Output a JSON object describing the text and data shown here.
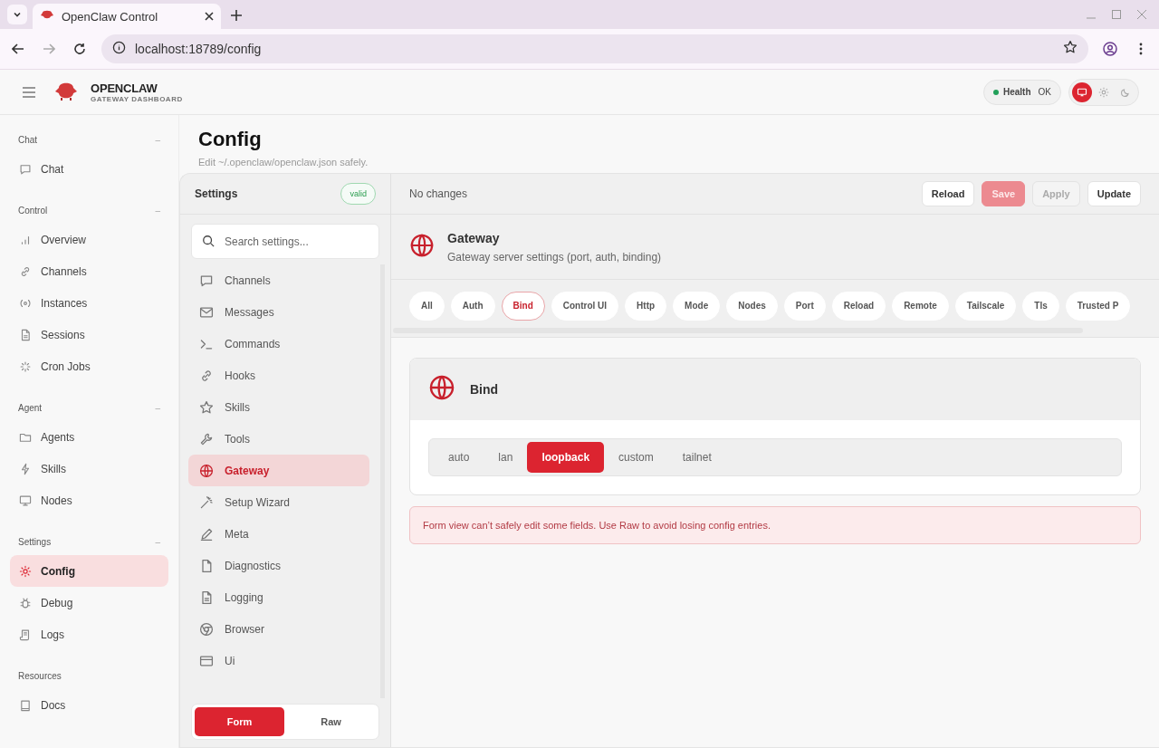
{
  "browser": {
    "tab_title": "OpenClaw Control",
    "url": "localhost:18789/config"
  },
  "app": {
    "brand": "OPENCLAW",
    "subtitle": "GATEWAY DASHBOARD",
    "health": {
      "label": "Health",
      "value": "OK"
    },
    "theme": [
      {
        "kind": "system",
        "selected": true
      },
      {
        "kind": "light",
        "selected": false
      },
      {
        "kind": "dark",
        "selected": false
      }
    ]
  },
  "sidebar": {
    "groups": [
      {
        "label": "Chat",
        "collapse": "–",
        "items": [
          {
            "label": "Chat",
            "selected": false
          }
        ]
      },
      {
        "label": "Control",
        "collapse": "–",
        "items": [
          {
            "label": "Overview",
            "selected": false
          },
          {
            "label": "Channels",
            "selected": false
          },
          {
            "label": "Instances",
            "selected": false
          },
          {
            "label": "Sessions",
            "selected": false
          },
          {
            "label": "Cron Jobs",
            "selected": false
          }
        ]
      },
      {
        "label": "Agent",
        "collapse": "–",
        "items": [
          {
            "label": "Agents",
            "selected": false
          },
          {
            "label": "Skills",
            "selected": false
          },
          {
            "label": "Nodes",
            "selected": false
          }
        ]
      },
      {
        "label": "Settings",
        "collapse": "–",
        "items": [
          {
            "label": "Config",
            "selected": true
          },
          {
            "label": "Debug",
            "selected": false
          },
          {
            "label": "Logs",
            "selected": false
          }
        ]
      },
      {
        "label": "Resources",
        "items": [
          {
            "label": "Docs",
            "selected": false
          }
        ]
      }
    ]
  },
  "page": {
    "title": "Config",
    "subtitle": "Edit ~/.openclaw/openclaw.json safely."
  },
  "settings": {
    "title": "Settings",
    "badge": "valid",
    "search": {
      "placeholder": "Search settings..."
    },
    "sections": [
      {
        "label": "Channels",
        "selected": false
      },
      {
        "label": "Messages",
        "selected": false
      },
      {
        "label": "Commands",
        "selected": false
      },
      {
        "label": "Hooks",
        "selected": false
      },
      {
        "label": "Skills",
        "selected": false
      },
      {
        "label": "Tools",
        "selected": false
      },
      {
        "label": "Gateway",
        "selected": true
      },
      {
        "label": "Setup Wizard",
        "selected": false
      },
      {
        "label": "Meta",
        "selected": false
      },
      {
        "label": "Diagnostics",
        "selected": false
      },
      {
        "label": "Logging",
        "selected": false
      },
      {
        "label": "Browser",
        "selected": false
      },
      {
        "label": "Ui",
        "selected": false
      }
    ],
    "modes": [
      {
        "label": "Form",
        "selected": true
      },
      {
        "label": "Raw",
        "selected": false
      }
    ]
  },
  "toolbar": {
    "status": "No changes",
    "buttons": [
      {
        "label": "Reload",
        "kind": "default",
        "disabled": false
      },
      {
        "label": "Save",
        "kind": "primary",
        "disabled": true
      },
      {
        "label": "Apply",
        "kind": "default",
        "disabled": true
      },
      {
        "label": "Update",
        "kind": "default",
        "disabled": false
      }
    ]
  },
  "section": {
    "title": "Gateway",
    "description": "Gateway server settings (port, auth, binding)",
    "chips": [
      {
        "label": "All",
        "selected": false
      },
      {
        "label": "Auth",
        "selected": false
      },
      {
        "label": "Bind",
        "selected": true
      },
      {
        "label": "Control UI",
        "selected": false
      },
      {
        "label": "Http",
        "selected": false
      },
      {
        "label": "Mode",
        "selected": false
      },
      {
        "label": "Nodes",
        "selected": false
      },
      {
        "label": "Port",
        "selected": false
      },
      {
        "label": "Reload",
        "selected": false
      },
      {
        "label": "Remote",
        "selected": false
      },
      {
        "label": "Tailscale",
        "selected": false
      },
      {
        "label": "Tls",
        "selected": false
      },
      {
        "label": "Trusted P",
        "selected": false
      }
    ]
  },
  "field": {
    "title": "Bind",
    "options": [
      {
        "label": "auto",
        "selected": false
      },
      {
        "label": "lan",
        "selected": false
      },
      {
        "label": "loopback",
        "selected": true
      },
      {
        "label": "custom",
        "selected": false
      },
      {
        "label": "tailnet",
        "selected": false
      }
    ]
  },
  "warning": "Form view can’t safely edit some fields. Use Raw to avoid losing config entries."
}
